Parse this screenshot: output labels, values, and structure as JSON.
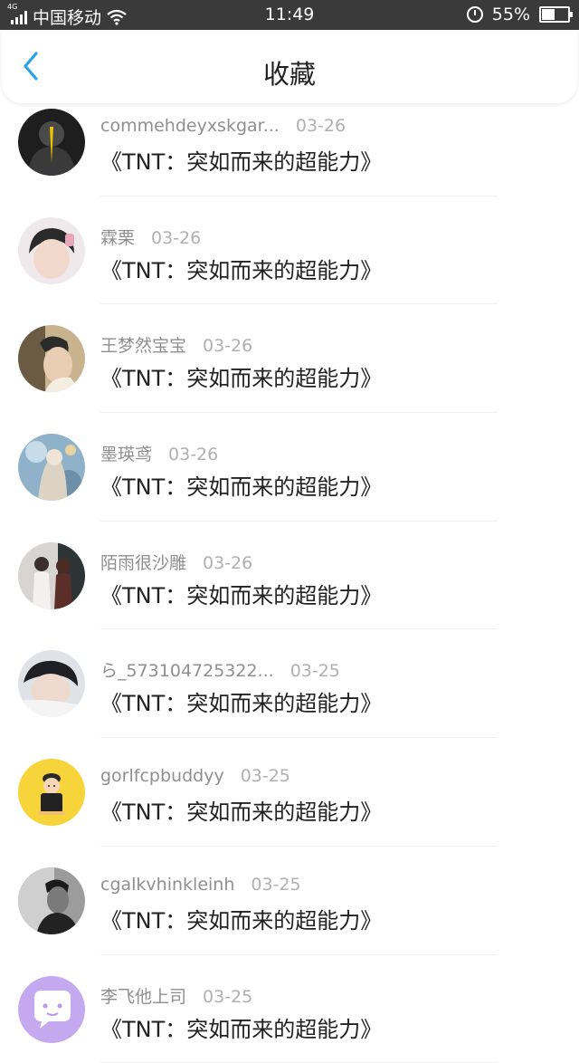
{
  "status_bar": {
    "network": "4G",
    "carrier": "中国移动",
    "time": "11:49",
    "battery_percent": "55%",
    "battery_level": 0.55
  },
  "header": {
    "title": "收藏",
    "back_icon": "chevron-left-icon",
    "accent_color": "#2aa1e6"
  },
  "items": [
    {
      "user": "commehdeyxskgar...",
      "date": "03-26",
      "title": "《TNT：突如而来的超能力》"
    },
    {
      "user": "霖栗",
      "date": "03-26",
      "title": "《TNT：突如而来的超能力》"
    },
    {
      "user": "王梦然宝宝",
      "date": "03-26",
      "title": "《TNT：突如而来的超能力》"
    },
    {
      "user": "墨瑛鸢",
      "date": "03-26",
      "title": "《TNT：突如而来的超能力》"
    },
    {
      "user": "陌雨很沙雕",
      "date": "03-26",
      "title": "《TNT：突如而来的超能力》"
    },
    {
      "user": "ら_573104725322...",
      "date": "03-25",
      "title": "《TNT：突如而来的超能力》"
    },
    {
      "user": "gorlfcpbuddyy",
      "date": "03-25",
      "title": "《TNT：突如而来的超能力》"
    },
    {
      "user": "cgalkvhinkleinh",
      "date": "03-25",
      "title": "《TNT：突如而来的超能力》"
    },
    {
      "user": "李飞他上司",
      "date": "03-25",
      "title": "《TNT：突如而来的超能力》"
    }
  ]
}
